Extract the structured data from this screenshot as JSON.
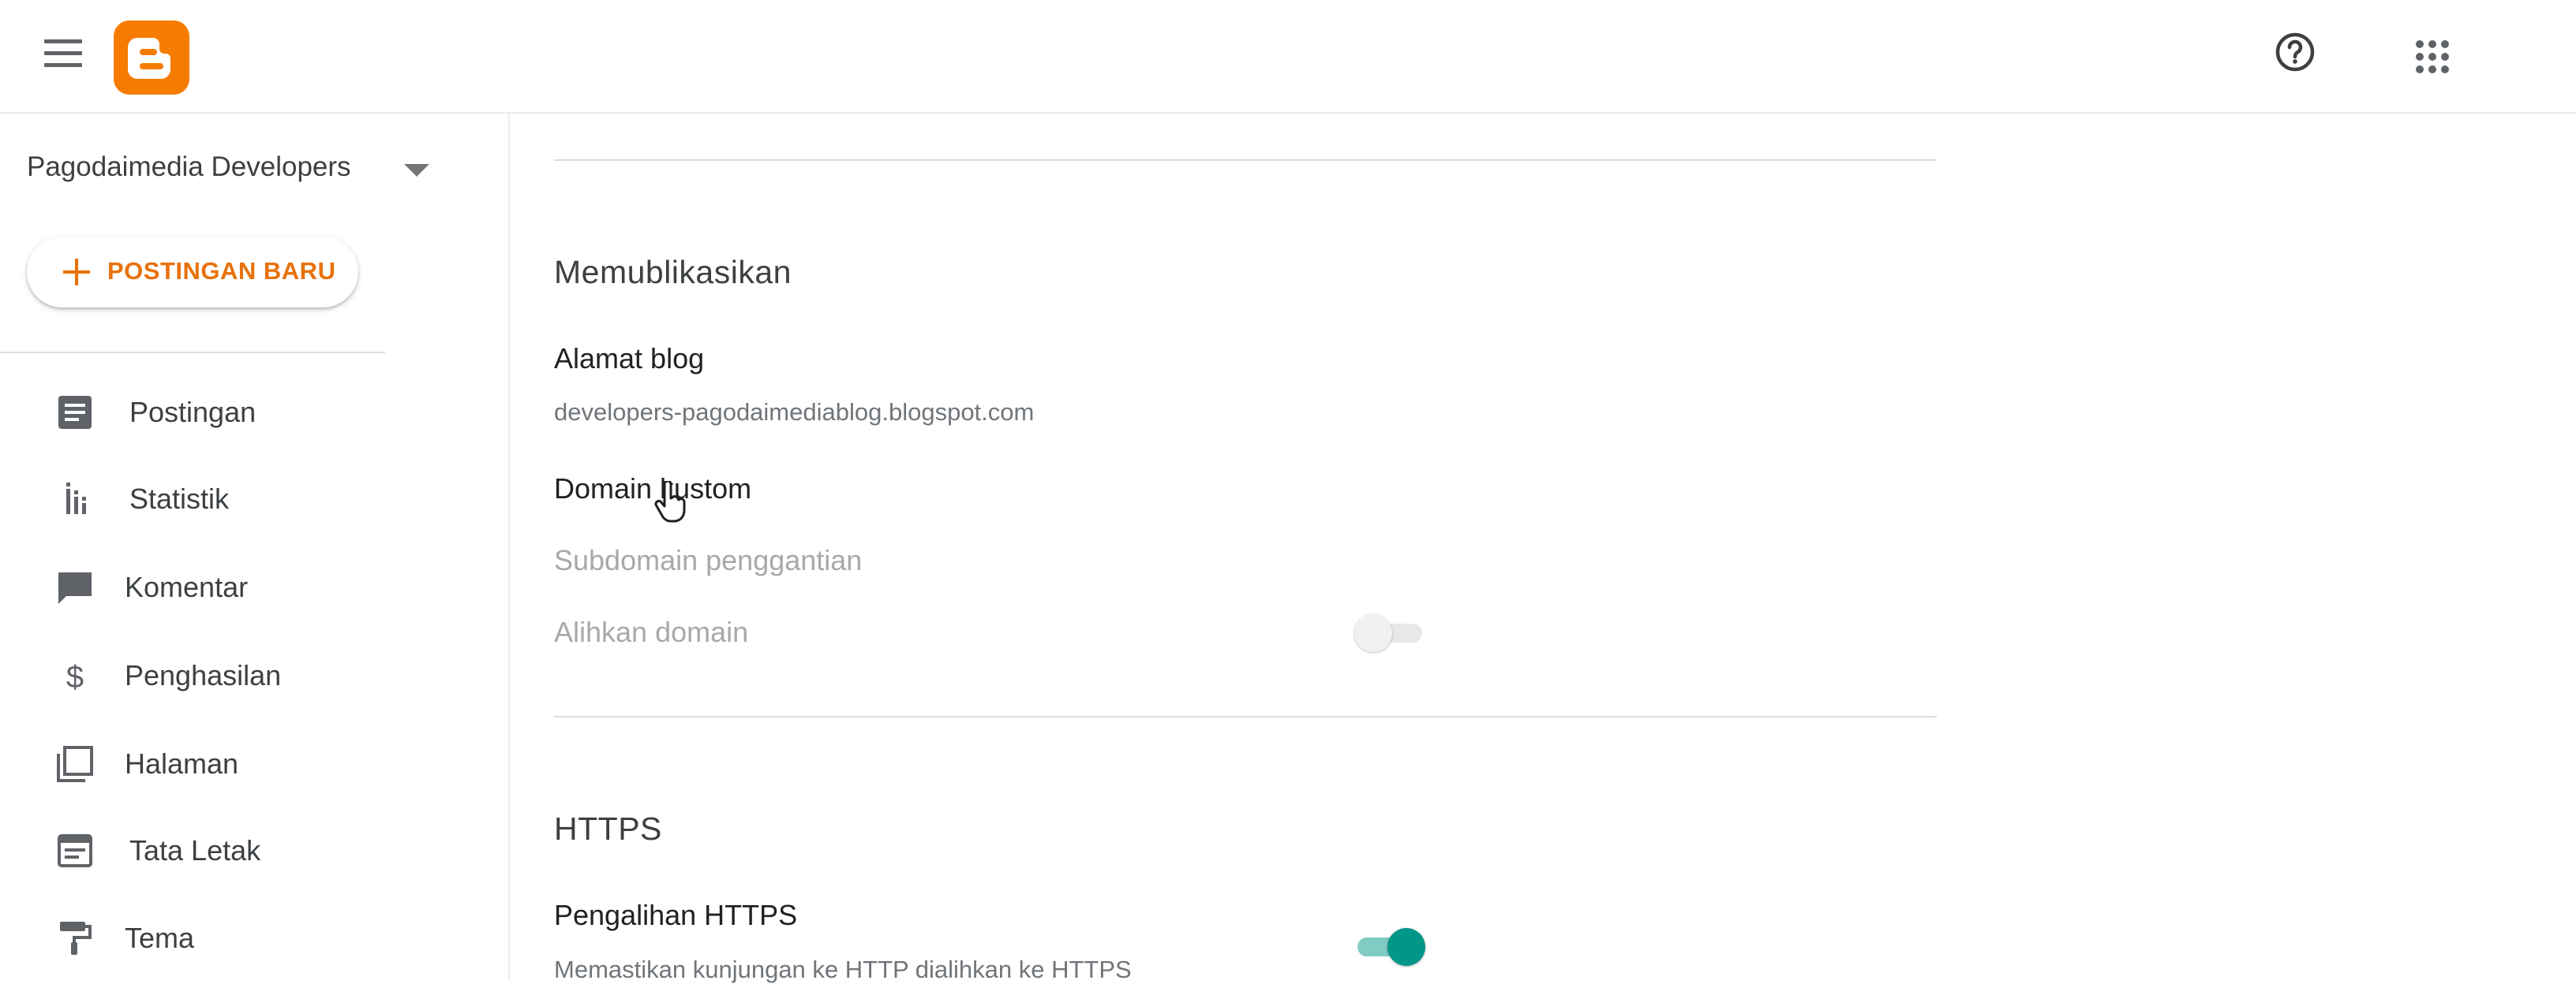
{
  "header": {
    "menu_icon": "hamburger-menu-icon",
    "logo_icon": "blogger-logo-icon",
    "help_icon": "help-circle-icon",
    "apps_icon": "google-apps-grid-icon",
    "brand_color": "#f57c00"
  },
  "sidebar": {
    "blog_name": "Pagodaimedia Developers",
    "new_post_label": "POSTINGAN BARU",
    "items": [
      {
        "label": "Postingan",
        "icon": "posts-icon"
      },
      {
        "label": "Statistik",
        "icon": "stats-icon"
      },
      {
        "label": "Komentar",
        "icon": "comment-icon"
      },
      {
        "label": "Penghasilan",
        "icon": "dollar-icon"
      },
      {
        "label": "Halaman",
        "icon": "pages-icon"
      },
      {
        "label": "Tata Letak",
        "icon": "layout-icon"
      },
      {
        "label": "Tema",
        "icon": "paint-roller-icon"
      }
    ]
  },
  "main": {
    "publish": {
      "heading": "Memublikasikan",
      "blog_address_title": "Alamat blog",
      "blog_address_value": "developers-pagodaimediablog.blogspot.com",
      "custom_domain_title": "Domain kustom",
      "fallback_subdomain_title": "Subdomain penggantian",
      "redirect_domain_title": "Alihkan domain",
      "redirect_domain_enabled": false
    },
    "https": {
      "heading": "HTTPS",
      "redirect_title": "Pengalihan HTTPS",
      "redirect_desc": "Memastikan kunjungan ke HTTP dialihkan ke HTTPS",
      "redirect_enabled": true
    }
  },
  "colors": {
    "accent_orange": "#e8710a",
    "toggle_on": "#009688",
    "icon_gray": "#5f6368"
  }
}
